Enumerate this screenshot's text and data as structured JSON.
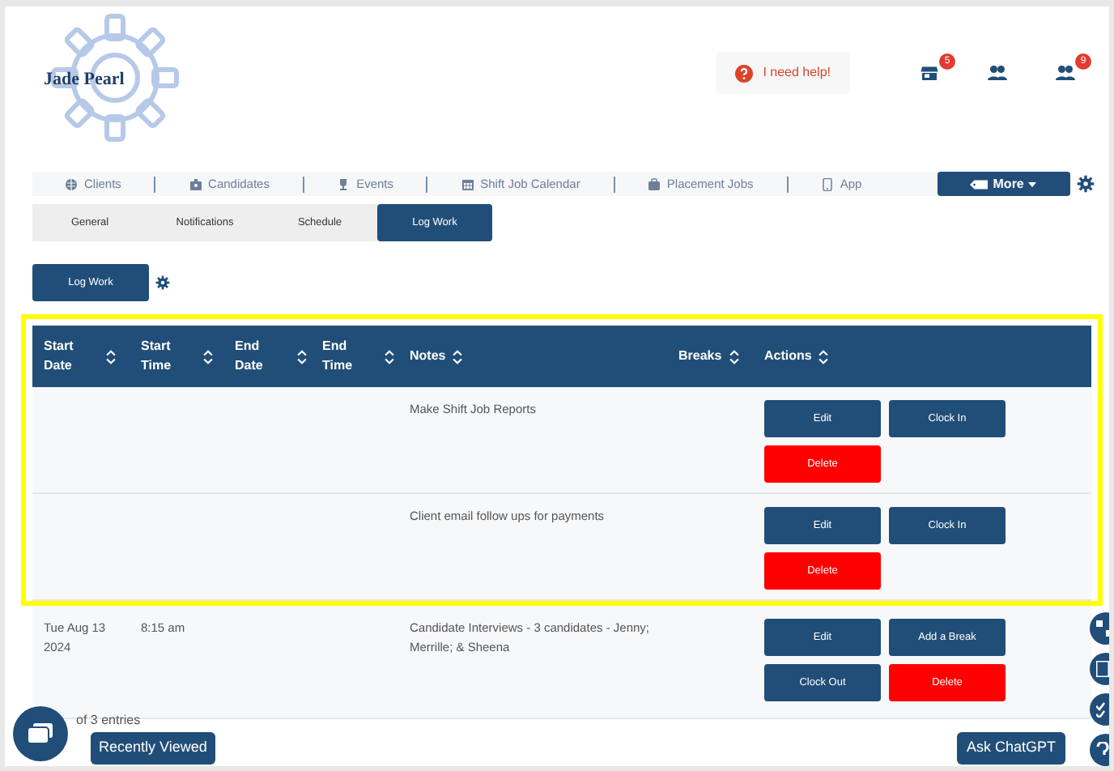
{
  "header": {
    "logo_text": "Jade Pearl",
    "help_button": "I need help!",
    "icons": [
      {
        "kind": "store",
        "badge": "5"
      },
      {
        "kind": "people"
      },
      {
        "kind": "people",
        "badge": "9"
      }
    ]
  },
  "nav": {
    "items": [
      {
        "label": "Clients"
      },
      {
        "label": "Candidates"
      },
      {
        "label": "Events"
      },
      {
        "label": "Shift Job Calendar"
      },
      {
        "label": "Placement Jobs"
      },
      {
        "label": "App"
      }
    ],
    "more_button": "More"
  },
  "tabs": [
    {
      "label": "General",
      "selected": false
    },
    {
      "label": "Notifications",
      "selected": false
    },
    {
      "label": "Schedule",
      "selected": false
    },
    {
      "label": "Log Work",
      "selected": true
    }
  ],
  "log_work_button": "Log Work",
  "table": {
    "columns": [
      {
        "label": "Start Date"
      },
      {
        "label": "Start Time"
      },
      {
        "label": "End Date"
      },
      {
        "label": "End Time"
      },
      {
        "label": "Notes"
      },
      {
        "label": "Breaks"
      },
      {
        "label": "Actions"
      }
    ],
    "rows": [
      {
        "highlighted": true,
        "cells": [
          "",
          "",
          "",
          "",
          "Make Shift Job Reports",
          ""
        ],
        "actions": [
          {
            "label": "Edit",
            "kind": "primary"
          },
          {
            "label": "Clock In",
            "kind": "primary"
          },
          {
            "label": "Delete",
            "kind": "danger"
          }
        ]
      },
      {
        "highlighted": true,
        "cells": [
          "",
          "",
          "",
          "",
          "Client email follow ups for payments",
          ""
        ],
        "actions": [
          {
            "label": "Edit",
            "kind": "primary"
          },
          {
            "label": "Clock In",
            "kind": "primary"
          },
          {
            "label": "Delete",
            "kind": "danger"
          }
        ]
      },
      {
        "highlighted": false,
        "cells": [
          "Tue Aug 13 2024",
          "8:15 am",
          "",
          "",
          "Candidate Interviews - 3 candidates - Jenny; Merrille; & Sheena",
          ""
        ],
        "actions": [
          {
            "label": "Edit",
            "kind": "primary"
          },
          {
            "label": "Add a Break",
            "kind": "primary"
          },
          {
            "label": "Clock Out",
            "kind": "primary"
          },
          {
            "label": "Delete",
            "kind": "danger"
          }
        ]
      }
    ]
  },
  "footer": {
    "entries_text": "of 3 entries",
    "recently_viewed": "Recently Viewed",
    "ask_button": "Ask ChatGPT"
  }
}
